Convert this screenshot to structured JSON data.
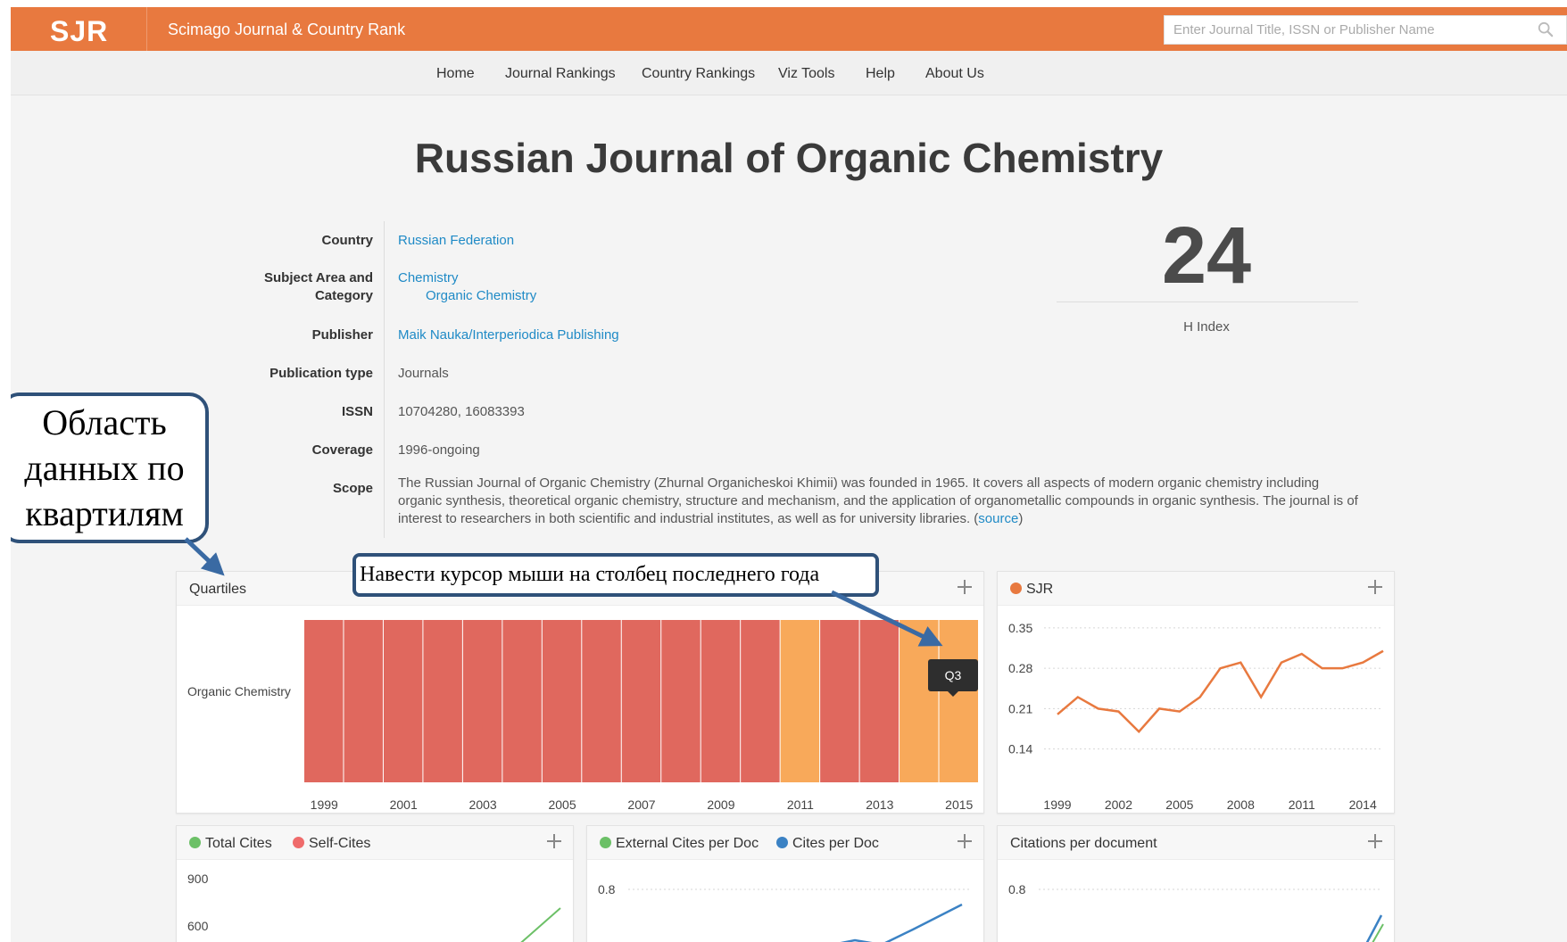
{
  "header": {
    "logo": "SJR",
    "site_name": "Scimago Journal & Country Rank",
    "search_placeholder": "Enter Journal Title, ISSN or Publisher Name"
  },
  "nav": [
    "Home",
    "Journal Rankings",
    "Country Rankings",
    "Viz Tools",
    "Help",
    "About Us"
  ],
  "journal": {
    "title": "Russian Journal of Organic Chemistry",
    "labels": {
      "country": "Country",
      "subject_line1": "Subject Area and",
      "subject_line2": "Category",
      "publisher": "Publisher",
      "pubtype": "Publication type",
      "issn": "ISSN",
      "coverage": "Coverage",
      "scope": "Scope"
    },
    "country": "Russian Federation",
    "subject_area": "Chemistry",
    "subject_category": "Organic Chemistry",
    "publisher": "Maik Nauka/Interperiodica Publishing",
    "publication_type": "Journals",
    "issn": "10704280, 16083393",
    "coverage": "1996-ongoing",
    "scope": "The Russian Journal of Organic Chemistry (Zhurnal Organicheskoi Khimii) was founded in 1965. It covers all aspects of modern organic chemistry including organic synthesis, theoretical organic chemistry, structure and mechanism, and the application of organometallic compounds in organic synthesis. The journal is of interest to researchers in both scientific and industrial institutes, as well as for university libraries. (",
    "scope_link": "source",
    "scope_end": ")",
    "h_index": "24",
    "h_index_label": "H Index"
  },
  "cards": {
    "quartiles_title": "Quartiles",
    "sjr_title": "SJR",
    "total_cites": "Total Cites",
    "self_cites": "Self-Cites",
    "external_cites": "External Cites per Doc",
    "cites_per_doc": "Cites per Doc",
    "citations_per_document": "Citations per document"
  },
  "tooltip": "Q3",
  "annotations": {
    "quartile_area": [
      "Область",
      "данных по",
      "квартилям"
    ],
    "hover_hint": "Навести курсор мыши на столбец последнего года"
  },
  "colors": {
    "header": "#e8793f",
    "q2": "#e0685e",
    "q3": "#f8a95a",
    "sjr_line": "#e8793f",
    "total_cites": "#6cc067",
    "self_cites": "#ef6b6b",
    "external_cites": "#6cc067",
    "cites_per_doc": "#3b82c4",
    "callout_border": "#2f5179"
  },
  "chart_data": [
    {
      "type": "heatmap",
      "title": "Quartiles",
      "category": "Organic Chemistry",
      "years": [
        1999,
        2000,
        2001,
        2002,
        2003,
        2004,
        2005,
        2006,
        2007,
        2008,
        2009,
        2010,
        2011,
        2012,
        2013,
        2014,
        2015
      ],
      "quartiles": [
        "Q2",
        "Q2",
        "Q2",
        "Q2",
        "Q2",
        "Q2",
        "Q2",
        "Q2",
        "Q2",
        "Q2",
        "Q2",
        "Q2",
        "Q3",
        "Q2",
        "Q2",
        "Q3",
        "Q3"
      ],
      "xticks": [
        1999,
        2001,
        2003,
        2005,
        2007,
        2009,
        2011,
        2013,
        2015
      ]
    },
    {
      "type": "line",
      "series": [
        {
          "name": "SJR",
          "x": [
            1999,
            2000,
            2001,
            2002,
            2003,
            2004,
            2005,
            2006,
            2007,
            2008,
            2009,
            2010,
            2011,
            2012,
            2013,
            2014,
            2015
          ],
          "values": [
            0.2,
            0.23,
            0.21,
            0.205,
            0.17,
            0.21,
            0.205,
            0.23,
            0.28,
            0.29,
            0.23,
            0.29,
            0.305,
            0.28,
            0.28,
            0.29,
            0.31
          ]
        }
      ],
      "ylim": [
        0.11,
        0.37
      ],
      "yticks": [
        0.14,
        0.21,
        0.28,
        0.35
      ],
      "xticks": [
        1999,
        2002,
        2005,
        2008,
        2011,
        2014
      ],
      "grid": true
    },
    {
      "type": "line",
      "yticks": [
        900,
        600
      ],
      "series": [
        {
          "name": "Total Cites",
          "values": []
        },
        {
          "name": "Self-Cites",
          "values": []
        }
      ]
    },
    {
      "type": "line",
      "yticks": [
        0.8
      ],
      "series": [
        {
          "name": "External Cites per Doc",
          "values": []
        },
        {
          "name": "Cites per Doc",
          "values": []
        }
      ]
    },
    {
      "type": "line",
      "title": "Citations per document",
      "yticks": [
        0.8
      ],
      "series": []
    }
  ]
}
